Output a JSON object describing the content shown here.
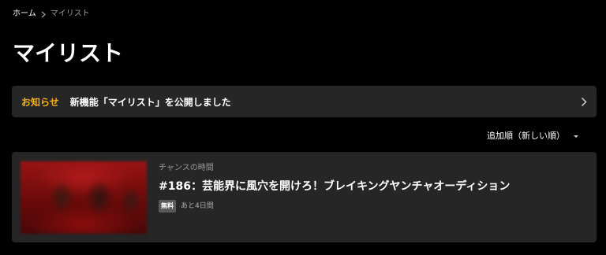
{
  "breadcrumb": {
    "home": "ホーム",
    "current": "マイリスト"
  },
  "page": {
    "title": "マイリスト"
  },
  "notice": {
    "tag": "お知らせ",
    "text": "新機能「マイリスト」を公開しました"
  },
  "sort": {
    "label": "追加順（新しい順）"
  },
  "items": [
    {
      "channel": "チャンスの時間",
      "title": "#186：芸能界に風穴を開けろ！ブレイキングヤンチャオーディション",
      "badge": "無料",
      "remaining": "あと4日間"
    }
  ],
  "colors": {
    "background": "#000000",
    "panel": "#262626",
    "accent": "#f5b01a",
    "muted_text": "#9a9a9a"
  },
  "icons": {
    "breadcrumb_separator": "chevron-right-icon",
    "notice_arrow": "chevron-right-icon",
    "sort_caret": "caret-down-icon"
  }
}
